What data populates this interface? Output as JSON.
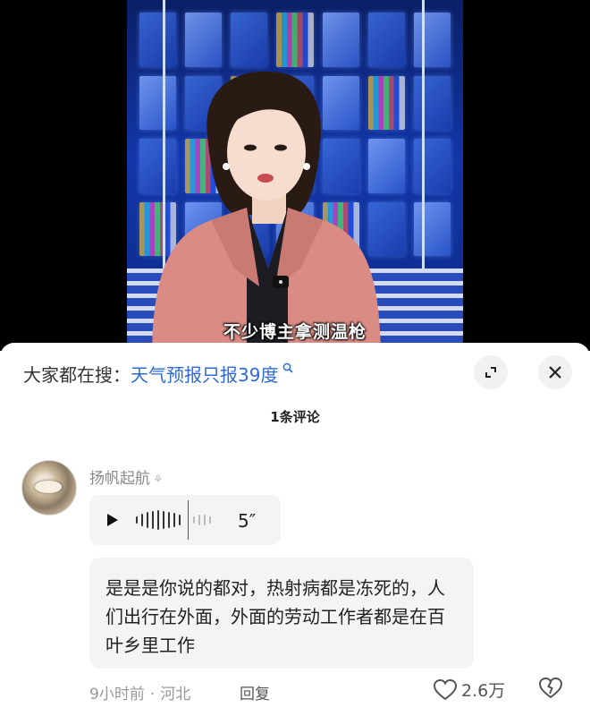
{
  "video": {
    "caption": "不少博主拿测温枪"
  },
  "panel": {
    "search_prefix": "大家都在搜：",
    "search_term": "天气预报只报39度",
    "comment_count": "1条评论"
  },
  "comment": {
    "username": "扬帆起航",
    "voice_duration": "5″",
    "text": "是是是你说的都对，热射病都是冻死的，人们出行在外面，外面的劳动工作者都是在百叶乡里工作",
    "time": "9小时前",
    "location": "河北",
    "reply_label": "回复",
    "likes": "2.6万"
  },
  "icons": {
    "search": "search-icon",
    "expand": "expand-icon",
    "close": "close-icon",
    "play": "play-icon",
    "heart": "heart-icon",
    "dislike": "broken-heart-icon"
  }
}
